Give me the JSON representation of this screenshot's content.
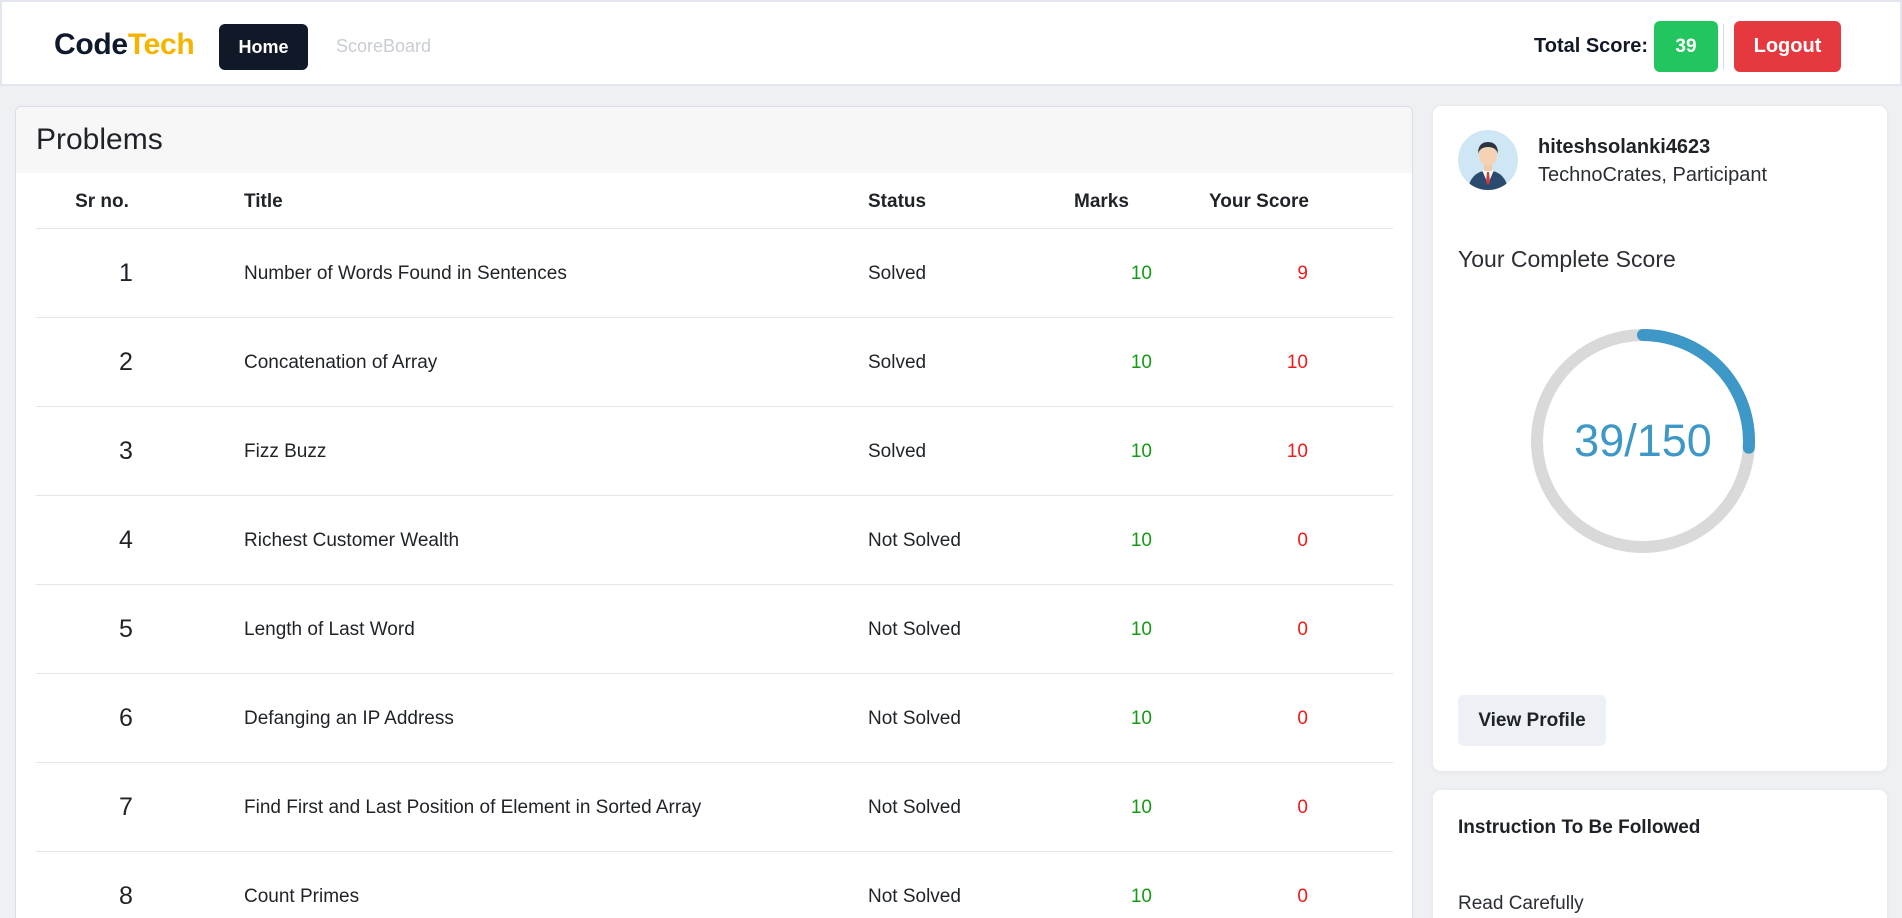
{
  "header": {
    "brand_part1": "Code",
    "brand_part2": "Tech",
    "nav_home": "Home",
    "nav_scoreboard": "ScoreBoard",
    "total_score_label": "Total Score:",
    "total_score_value": "39",
    "logout_label": "Logout"
  },
  "problems": {
    "title": "Problems",
    "columns": [
      "Sr no.",
      "Title",
      "Status",
      "Marks",
      "Your Score"
    ],
    "rows": [
      {
        "sr": "1",
        "title": "Number of Words Found in Sentences",
        "status": "Solved",
        "marks": "10",
        "score": "9"
      },
      {
        "sr": "2",
        "title": "Concatenation of Array",
        "status": "Solved",
        "marks": "10",
        "score": "10"
      },
      {
        "sr": "3",
        "title": "Fizz Buzz",
        "status": "Solved",
        "marks": "10",
        "score": "10"
      },
      {
        "sr": "4",
        "title": "Richest Customer Wealth",
        "status": "Not Solved",
        "marks": "10",
        "score": "0"
      },
      {
        "sr": "5",
        "title": "Length of Last Word",
        "status": "Not Solved",
        "marks": "10",
        "score": "0"
      },
      {
        "sr": "6",
        "title": "Defanging an IP Address",
        "status": "Not Solved",
        "marks": "10",
        "score": "0"
      },
      {
        "sr": "7",
        "title": "Find First and Last Position of Element in Sorted Array",
        "status": "Not Solved",
        "marks": "10",
        "score": "0"
      },
      {
        "sr": "8",
        "title": "Count Primes",
        "status": "Not Solved",
        "marks": "10",
        "score": "0"
      }
    ]
  },
  "profile": {
    "avatar_icon": "user-avatar-icon",
    "username": "hiteshsolanki4623",
    "affiliation": "TechnoCrates, Participant",
    "complete_score_label": "Your Complete Score",
    "score_text": "39/150",
    "score_fraction": 0.26,
    "view_profile_label": "View Profile"
  },
  "instructions": {
    "title": "Instruction To Be Followed",
    "text": "Read Carefully"
  },
  "colors": {
    "primary_dark": "#111827",
    "brand_accent": "#f4b400",
    "success": "#22c55e",
    "danger": "#e5393f",
    "marks_green": "#149a14",
    "score_red": "#ef1b1b",
    "gauge_blue": "#3d97c7",
    "gauge_track": "#d9d9d9"
  }
}
